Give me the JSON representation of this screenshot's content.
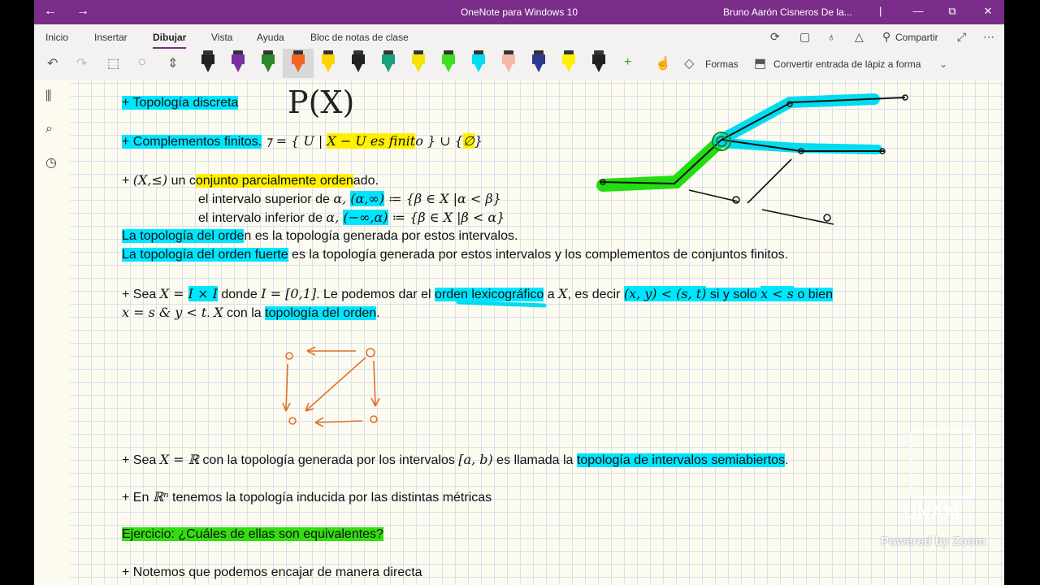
{
  "window": {
    "title": "OneNote para Windows 10",
    "user": "Bruno Aarón Cisneros De la...",
    "back_icon": "←",
    "forward_icon": "→",
    "minimize_icon": "—",
    "maximize_icon": "⧉",
    "close_icon": "✕"
  },
  "ribbon": {
    "tabs": [
      "Inicio",
      "Insertar",
      "Dibujar",
      "Vista",
      "Ayuda",
      "Bloc de notas de clase"
    ],
    "active_tab": "Dibujar",
    "share_label": "Compartir"
  },
  "toolbar": {
    "shapes_label": "Formas",
    "convert_label": "Convertir entrada de lápiz a forma",
    "pens": [
      {
        "name": "black",
        "color": "#222222"
      },
      {
        "name": "purple",
        "color": "#7b2fa0"
      },
      {
        "name": "green",
        "color": "#2a8a2a"
      },
      {
        "name": "orange",
        "color": "#f26522"
      },
      {
        "name": "yellow",
        "color": "#ffd400"
      },
      {
        "name": "black2",
        "color": "#222222"
      },
      {
        "name": "teal",
        "color": "#1aa17b"
      },
      {
        "name": "hl-yellow",
        "color": "#f5e400"
      },
      {
        "name": "hl-green",
        "color": "#44dd22"
      },
      {
        "name": "hl-cyan",
        "color": "#00dcf0"
      },
      {
        "name": "hl-pink",
        "color": "#f5b9a6"
      },
      {
        "name": "galaxy",
        "color": "#2d3a8c"
      },
      {
        "name": "hl-yellow2",
        "color": "#fff200"
      },
      {
        "name": "black3",
        "color": "#222222"
      }
    ]
  },
  "content": {
    "line1": "+ Topología discreta",
    "line2_label": "+ Complementos finitos.",
    "line2_math_a": "⁊ = { U | ",
    "line2_math_b": "X − U es finit",
    "line2_math_c": "o } ∪ {",
    "line2_math_d": "∅",
    "line2_math_e": "}",
    "line3_a": "+ ",
    "line3_b": "(X,≤)",
    "line3_c": " un c",
    "line3_d": "onjunto parcialmente orden",
    "line3_e": "ado.",
    "line4_a": "el intervalo superior de ",
    "line4_b": "α, ",
    "line4_c": "(α,∞)",
    "line4_d": " ≔ {β ∈ X |α < β}",
    "line5_a": "el intervalo inferior de ",
    "line5_b": "α, ",
    "line5_c": "(−∞,α)",
    "line5_d": " ≔ {β ∈ X |β < α}",
    "line6_a": "La topología del orde",
    "line6_b": "n es la topología generada por estos intervalos.",
    "line7_a": "La topología del orden fuerte",
    "line7_b": " es la topología generada por estos intervalos y los complementos de conjuntos finitos.",
    "line8_a": "+ Sea ",
    "line8_b": "X = ",
    "line8_c": "I × I",
    "line8_d": " donde ",
    "line8_e": "I = [0,1]",
    "line8_f": ". Le podemos dar el ",
    "line8_g": "orden lexicográfico",
    "line8_h": " a ",
    "line8_i": "X",
    "line8_j": ", es decir ",
    "line8_k": "(x, y) < (s, t)",
    "line8_l": " si y solo ",
    "line8_m": "x < s",
    "line8_n": " o bien",
    "line9_a": "x = s & y < t",
    "line9_b": ".   ",
    "line9_c": "X",
    "line9_d": " con la ",
    "line9_e": "topología del orden",
    "line9_f": ".",
    "line10_a": "+ Sea ",
    "line10_b": "X = ℝ",
    "line10_c": "  con la topología generada por los intervalos ",
    "line10_d": "[a, b)",
    "line10_e": "  es llamada la ",
    "line10_f": "topología de intervalos semiabiertos",
    "line10_g": ".",
    "line11_a": "+ En ",
    "line11_b": "ℝⁿ",
    "line11_c": " tenemos la topología inducida por las distintas métricas",
    "line12": "Ejercicio: ¿Cuáles de ellas son equivalentes?",
    "line13": "+ Notemos que podemos encajar de manera directa",
    "handwritten": "P(X)"
  },
  "overlay": {
    "unam": "UNAM",
    "zoom": "Powered by Zoom"
  }
}
